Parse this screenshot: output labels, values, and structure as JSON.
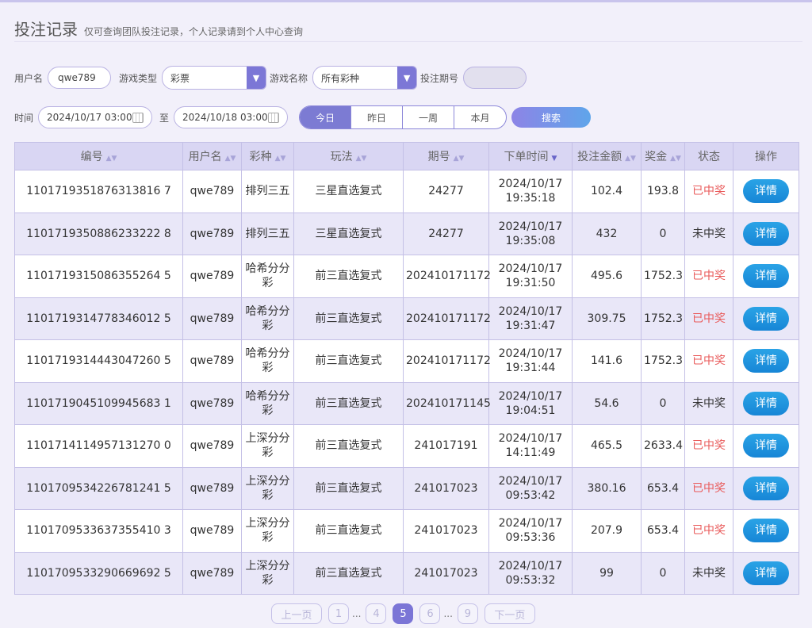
{
  "header": {
    "title": "投注记录",
    "subtitle": "仅可查询团队投注记录，个人记录请到个人中心查询"
  },
  "filters": {
    "username_label": "用户名",
    "username_value": "qwe789",
    "game_type_label": "游戏类型",
    "game_type_value": "彩票",
    "game_name_label": "游戏名称",
    "game_name_value": "所有彩种",
    "issue_label": "投注期号",
    "issue_value": "",
    "time_label": "时间",
    "start_time": "2024/10/17 03:00",
    "to_label": "至",
    "end_time": "2024/10/18 03:00",
    "quick_ranges": [
      "今日",
      "昨日",
      "一周",
      "本月"
    ],
    "active_range": "今日",
    "search_label": "搜索"
  },
  "table": {
    "columns": [
      "编号",
      "用户名",
      "彩种",
      "玩法",
      "期号",
      "下单时间",
      "投注金额",
      "奖金",
      "状态",
      "操作"
    ],
    "detail_label": "详情",
    "rows": [
      {
        "id": "1101719351876313816 7",
        "user": "qwe789",
        "lottery": "排列三五",
        "play": "三星直选复式",
        "issue": "24277",
        "date": "2024/10/17",
        "time": "19:35:18",
        "amount": "102.4",
        "prize": "193.8",
        "status": "已中奖",
        "win": true
      },
      {
        "id": "1101719350886233222 8",
        "user": "qwe789",
        "lottery": "排列三五",
        "play": "三星直选复式",
        "issue": "24277",
        "date": "2024/10/17",
        "time": "19:35:08",
        "amount": "432",
        "prize": "0",
        "status": "未中奖",
        "win": false
      },
      {
        "id": "1101719315086355264 5",
        "user": "qwe789",
        "lottery": "哈希分分彩",
        "play": "前三直选复式",
        "issue": "202410171172",
        "date": "2024/10/17",
        "time": "19:31:50",
        "amount": "495.6",
        "prize": "1752.3",
        "status": "已中奖",
        "win": true
      },
      {
        "id": "1101719314778346012 5",
        "user": "qwe789",
        "lottery": "哈希分分彩",
        "play": "前三直选复式",
        "issue": "202410171172",
        "date": "2024/10/17",
        "time": "19:31:47",
        "amount": "309.75",
        "prize": "1752.3",
        "status": "已中奖",
        "win": true
      },
      {
        "id": "1101719314443047260 5",
        "user": "qwe789",
        "lottery": "哈希分分彩",
        "play": "前三直选复式",
        "issue": "202410171172",
        "date": "2024/10/17",
        "time": "19:31:44",
        "amount": "141.6",
        "prize": "1752.3",
        "status": "已中奖",
        "win": true
      },
      {
        "id": "1101719045109945683 1",
        "user": "qwe789",
        "lottery": "哈希分分彩",
        "play": "前三直选复式",
        "issue": "202410171145",
        "date": "2024/10/17",
        "time": "19:04:51",
        "amount": "54.6",
        "prize": "0",
        "status": "未中奖",
        "win": false
      },
      {
        "id": "1101714114957131270 0",
        "user": "qwe789",
        "lottery": "上深分分彩",
        "play": "前三直选复式",
        "issue": "241017191",
        "date": "2024/10/17",
        "time": "14:11:49",
        "amount": "465.5",
        "prize": "2633.4",
        "status": "已中奖",
        "win": true
      },
      {
        "id": "1101709534226781241 5",
        "user": "qwe789",
        "lottery": "上深分分彩",
        "play": "前三直选复式",
        "issue": "241017023",
        "date": "2024/10/17",
        "time": "09:53:42",
        "amount": "380.16",
        "prize": "653.4",
        "status": "已中奖",
        "win": true
      },
      {
        "id": "1101709533637355410 3",
        "user": "qwe789",
        "lottery": "上深分分彩",
        "play": "前三直选复式",
        "issue": "241017023",
        "date": "2024/10/17",
        "time": "09:53:36",
        "amount": "207.9",
        "prize": "653.4",
        "status": "已中奖",
        "win": true
      },
      {
        "id": "1101709533290669692 5",
        "user": "qwe789",
        "lottery": "上深分分彩",
        "play": "前三直选复式",
        "issue": "241017023",
        "date": "2024/10/17",
        "time": "09:53:32",
        "amount": "99",
        "prize": "0",
        "status": "未中奖",
        "win": false
      }
    ]
  },
  "pager": {
    "prev_label": "上一页",
    "next_label": "下一页",
    "pages": [
      "1",
      "4",
      "5",
      "6",
      "9"
    ],
    "current": "5",
    "ellipsis": "..."
  },
  "colors": {
    "accent": "#7c77d6",
    "win": "#e95a5a",
    "detail_button": "#1f95e0"
  }
}
